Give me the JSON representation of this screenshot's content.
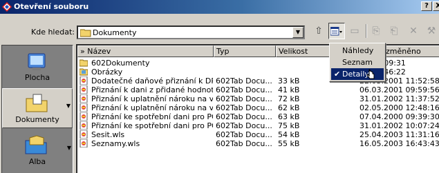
{
  "window": {
    "title": "Otevření souboru",
    "help_label": "?",
    "close_label": "X"
  },
  "lookin": {
    "label": "Kde hledat:",
    "value": "Dokumenty"
  },
  "places": [
    {
      "label": "Plocha",
      "icon": "desktop-icon"
    },
    {
      "label": "Dokumenty",
      "icon": "documents-folder-icon"
    },
    {
      "label": "Alba",
      "icon": "albums-folder-icon"
    }
  ],
  "columns": {
    "name": "» Název",
    "type": "Typ",
    "size": "Velikost",
    "modified": "změněno"
  },
  "files": [
    {
      "name": "602Dokumenty",
      "type": "",
      "size": "",
      "modified": "03 09:09:31",
      "icon": "folder-icon"
    },
    {
      "name": "Obrázky",
      "type": "",
      "size": "",
      "modified": "03 07:46:22",
      "icon": "pictures-folder-icon"
    },
    {
      "name": "Dodatečné daňové přiznání k DPH....",
      "type": "602Tab Docu...",
      "size": "33 kB",
      "modified": "22.03.2001 11:52:58",
      "icon": "602tab-doc-icon"
    },
    {
      "name": "Přiznání k dani z přidané hodnoty.wls",
      "type": "602Tab Docu...",
      "size": "41 kB",
      "modified": "06.03.2001 09:59:56",
      "icon": "602tab-doc-icon"
    },
    {
      "name": "Přiznání k uplatnění nároku na vrá...",
      "type": "602Tab Docu...",
      "size": "72 kB",
      "modified": "31.01.2002 11:37:52",
      "icon": "602tab-doc-icon"
    },
    {
      "name": "Přiznání k uplatnění nároku na vrá...",
      "type": "602Tab Docu...",
      "size": "62 kB",
      "modified": "02.05.2000 12:48:16",
      "icon": "602tab-doc-icon"
    },
    {
      "name": "Přiznání ke spotřební dani pro PO.wls",
      "type": "602Tab Docu...",
      "size": "63 kB",
      "modified": "07.04.2000 09:39:30",
      "icon": "602tab-doc-icon"
    },
    {
      "name": "Přiznání ke spotřební dani pro PO ...",
      "type": "602Tab Docu...",
      "size": "75 kB",
      "modified": "31.01.2002 10:07:24",
      "icon": "602tab-doc-icon"
    },
    {
      "name": "Sesit.wls",
      "type": "602Tab Docu...",
      "size": "54 kB",
      "modified": "25.04.2003 11:31:16",
      "icon": "602tab-doc-icon"
    },
    {
      "name": "Seznamy.wls",
      "type": "602Tab Docu...",
      "size": "55 kB",
      "modified": "16.05.2003 16:43:43",
      "icon": "602tab-doc-icon"
    }
  ],
  "view_menu": {
    "items": [
      {
        "label": "Náhledy",
        "selected": false
      },
      {
        "label": "Seznam",
        "selected": false
      },
      {
        "label": "Detaily",
        "selected": true
      }
    ],
    "check": "✔"
  },
  "colors": {
    "title_start": "#0a246a",
    "title_end": "#a6caf0",
    "menu_highlight": "#0a246a",
    "face": "#d4d0c8"
  }
}
